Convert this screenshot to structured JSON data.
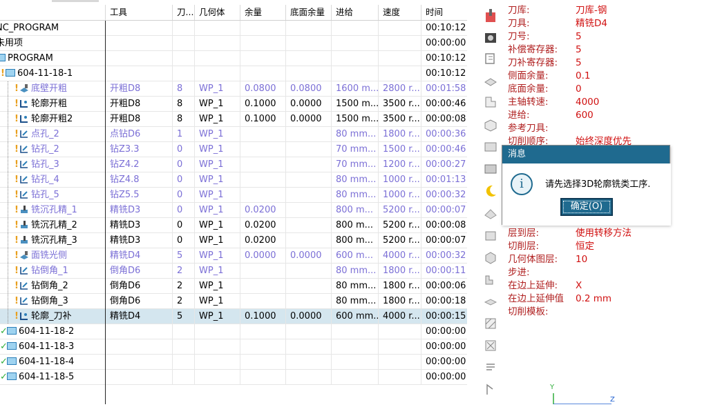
{
  "navigator": {
    "columns": [
      "工具",
      "刀...",
      "几何体",
      "余量",
      "底面余量",
      "进给",
      "速度",
      "时间"
    ],
    "rows": [
      {
        "level": 0,
        "marker": "",
        "icon": "",
        "name": "NC_PROGRAM",
        "tool": "",
        "tn": "",
        "geom": "",
        "stock": "",
        "floor": "",
        "feed": "",
        "speed": "",
        "time": "00:10:12",
        "blue": false,
        "sel": false
      },
      {
        "level": 0,
        "marker": "",
        "icon": "",
        "name": "未用项",
        "tool": "",
        "tn": "",
        "geom": "",
        "stock": "",
        "floor": "",
        "feed": "",
        "speed": "",
        "time": "00:00:00",
        "blue": false,
        "sel": false
      },
      {
        "level": 0,
        "marker": "",
        "icon": "folder",
        "name": "PROGRAM",
        "tool": "",
        "tn": "",
        "geom": "",
        "stock": "",
        "floor": "",
        "feed": "",
        "speed": "",
        "time": "00:10:12",
        "blue": false,
        "sel": false
      },
      {
        "level": 1,
        "marker": "!",
        "icon": "folder",
        "name": "604-11-18-1",
        "tool": "",
        "tn": "",
        "geom": "",
        "stock": "",
        "floor": "",
        "feed": "",
        "speed": "",
        "time": "00:10:12",
        "blue": false,
        "sel": false
      },
      {
        "level": 2,
        "marker": "!",
        "icon": "floor",
        "name": "底壁开粗",
        "tool": "开粗D8",
        "tn": "8",
        "geom": "WP_1",
        "stock": "0.0800",
        "floor": "0.0800",
        "feed": "1600 m...",
        "speed": "2800 r...",
        "time": "00:01:58",
        "blue": true,
        "sel": false
      },
      {
        "level": 2,
        "marker": "!",
        "icon": "contour",
        "name": "轮廓开粗",
        "tool": "开粗D8",
        "tn": "8",
        "geom": "WP_1",
        "stock": "0.1000",
        "floor": "0.0000",
        "feed": "1500 m...",
        "speed": "3500 r...",
        "time": "00:00:46",
        "blue": false,
        "sel": false
      },
      {
        "level": 2,
        "marker": "!",
        "icon": "contour",
        "name": "轮廓开粗2",
        "tool": "开粗D8",
        "tn": "8",
        "geom": "WP_1",
        "stock": "0.1000",
        "floor": "0.0000",
        "feed": "1500 m...",
        "speed": "3500 r...",
        "time": "00:00:08",
        "blue": false,
        "sel": false
      },
      {
        "level": 2,
        "marker": "!",
        "icon": "drill",
        "name": "点孔_2",
        "tool": "点钻D6",
        "tn": "1",
        "geom": "WP_1",
        "stock": "",
        "floor": "",
        "feed": "80 mm...",
        "speed": "1800 r...",
        "time": "00:00:36",
        "blue": true,
        "sel": false
      },
      {
        "level": 2,
        "marker": "!",
        "icon": "drill",
        "name": "钻孔_2",
        "tool": "钻Z3.3",
        "tn": "0",
        "geom": "WP_1",
        "stock": "",
        "floor": "",
        "feed": "70 mm...",
        "speed": "1500 r...",
        "time": "00:00:46",
        "blue": true,
        "sel": false
      },
      {
        "level": 2,
        "marker": "!",
        "icon": "drill",
        "name": "钻孔_3",
        "tool": "钻Z4.2",
        "tn": "0",
        "geom": "WP_1",
        "stock": "",
        "floor": "",
        "feed": "70 mm...",
        "speed": "1200 r...",
        "time": "00:00:27",
        "blue": true,
        "sel": false
      },
      {
        "level": 2,
        "marker": "!",
        "icon": "drill",
        "name": "钻孔_4",
        "tool": "钻Z4.8",
        "tn": "0",
        "geom": "WP_1",
        "stock": "",
        "floor": "",
        "feed": "80 mm...",
        "speed": "1000 r...",
        "time": "00:01:13",
        "blue": true,
        "sel": false
      },
      {
        "level": 2,
        "marker": "!",
        "icon": "drill",
        "name": "钻孔_5",
        "tool": "钻Z5.5",
        "tn": "0",
        "geom": "WP_1",
        "stock": "",
        "floor": "",
        "feed": "80 mm...",
        "speed": "1000 r...",
        "time": "00:00:32",
        "blue": true,
        "sel": false
      },
      {
        "level": 2,
        "marker": "!",
        "icon": "mill",
        "name": "铣沉孔精_1",
        "tool": "精铣D3",
        "tn": "0",
        "geom": "WP_1",
        "stock": "0.0200",
        "floor": "",
        "feed": "800 m...",
        "speed": "5200 r...",
        "time": "00:00:07",
        "blue": true,
        "sel": false
      },
      {
        "level": 2,
        "marker": "!",
        "icon": "mill",
        "name": "铣沉孔精_2",
        "tool": "精铣D3",
        "tn": "0",
        "geom": "WP_1",
        "stock": "0.0200",
        "floor": "",
        "feed": "800 m...",
        "speed": "5200 r...",
        "time": "00:00:08",
        "blue": false,
        "sel": false
      },
      {
        "level": 2,
        "marker": "!",
        "icon": "mill",
        "name": "铣沉孔精_3",
        "tool": "精铣D3",
        "tn": "0",
        "geom": "WP_1",
        "stock": "0.0200",
        "floor": "",
        "feed": "800 m...",
        "speed": "5200 r...",
        "time": "00:00:07",
        "blue": false,
        "sel": false
      },
      {
        "level": 2,
        "marker": "!",
        "icon": "floor",
        "name": "面铣光侧",
        "tool": "精铣D4",
        "tn": "5",
        "geom": "WP_1",
        "stock": "0.0000",
        "floor": "0.0000",
        "feed": "600 m...",
        "speed": "4000 r...",
        "time": "00:00:32",
        "blue": true,
        "sel": false
      },
      {
        "level": 2,
        "marker": "!",
        "icon": "drill",
        "name": "钻倒角_1",
        "tool": "倒角D6",
        "tn": "2",
        "geom": "WP_1",
        "stock": "",
        "floor": "",
        "feed": "80 mm...",
        "speed": "1800 r...",
        "time": "00:00:11",
        "blue": true,
        "sel": false
      },
      {
        "level": 2,
        "marker": "!",
        "icon": "drill",
        "name": "钻倒角_2",
        "tool": "倒角D6",
        "tn": "2",
        "geom": "WP_1",
        "stock": "",
        "floor": "",
        "feed": "80 mm...",
        "speed": "1800 r...",
        "time": "00:00:06",
        "blue": false,
        "sel": false
      },
      {
        "level": 2,
        "marker": "!",
        "icon": "drill",
        "name": "钻倒角_3",
        "tool": "倒角D6",
        "tn": "2",
        "geom": "WP_1",
        "stock": "",
        "floor": "",
        "feed": "80 mm...",
        "speed": "1800 r...",
        "time": "00:00:18",
        "blue": false,
        "sel": false
      },
      {
        "level": 2,
        "marker": "!",
        "icon": "contour",
        "name": "轮廓_刀补",
        "tool": "精铣D4",
        "tn": "5",
        "geom": "WP_1",
        "stock": "0.1000",
        "floor": "0.0000",
        "feed": "600 mm...",
        "speed": "4000 r...",
        "time": "00:00:15",
        "blue": false,
        "sel": true
      },
      {
        "level": 1,
        "marker": "✓",
        "icon": "folder",
        "name": "604-11-18-2",
        "tool": "",
        "tn": "",
        "geom": "",
        "stock": "",
        "floor": "",
        "feed": "",
        "speed": "",
        "time": "00:00:00",
        "blue": false,
        "sel": false
      },
      {
        "level": 1,
        "marker": "✓",
        "icon": "folder",
        "name": "604-11-18-3",
        "tool": "",
        "tn": "",
        "geom": "",
        "stock": "",
        "floor": "",
        "feed": "",
        "speed": "",
        "time": "00:00:00",
        "blue": false,
        "sel": false
      },
      {
        "level": 1,
        "marker": "✓",
        "icon": "folder",
        "name": "604-11-18-4",
        "tool": "",
        "tn": "",
        "geom": "",
        "stock": "",
        "floor": "",
        "feed": "",
        "speed": "",
        "time": "00:00:00",
        "blue": false,
        "sel": false
      },
      {
        "level": 1,
        "marker": "✓",
        "icon": "folder",
        "name": "604-11-18-5",
        "tool": "",
        "tn": "",
        "geom": "",
        "stock": "",
        "floor": "",
        "feed": "",
        "speed": "",
        "time": "00:00:00",
        "blue": false,
        "sel": false
      }
    ]
  },
  "props_top": [
    {
      "k": "刀库:",
      "v": "刀库-钢"
    },
    {
      "k": "刀具:",
      "v": "精铣D4"
    },
    {
      "k": "刀号:",
      "v": "5"
    },
    {
      "k": "补偿寄存器:",
      "v": "5"
    },
    {
      "k": "刀补寄存器:",
      "v": "5"
    },
    {
      "k": "侧面余量:",
      "v": "0.1"
    },
    {
      "k": "底面余量:",
      "v": "0"
    },
    {
      "k": "主轴转速:",
      "v": "4000"
    },
    {
      "k": "进给:",
      "v": "600"
    },
    {
      "k": "参考刀具:",
      "v": ""
    },
    {
      "k": "切削顺序:",
      "v": "始终深度优先"
    }
  ],
  "props_bottom": [
    {
      "k": "层到层:",
      "v": "使用转移方法"
    },
    {
      "k": "切削层:",
      "v": "恒定"
    },
    {
      "k": "几何体图层:",
      "v": "10"
    },
    {
      "k": "步进:",
      "v": ""
    },
    {
      "k": "在边上延伸:",
      "v": "X"
    },
    {
      "k": "在边上延伸值",
      "v": "0.2   mm"
    },
    {
      "k": "切削模板:",
      "v": ""
    }
  ],
  "dialog": {
    "title": "消息",
    "message": "请先选择3D轮廓铣类工序.",
    "ok_label": "确定(O)",
    "info_glyph": "i"
  },
  "axis": {
    "y": "Y",
    "z": "Z"
  }
}
